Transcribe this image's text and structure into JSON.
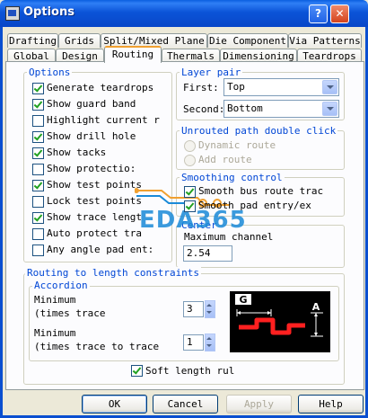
{
  "window": {
    "title": "Options",
    "help_symbol": "?",
    "close_symbol": "✕"
  },
  "tabs_row1": [
    "Drafting",
    "Grids",
    "Split/Mixed Plane",
    "Die Component",
    "Via Patterns"
  ],
  "tabs_row2": [
    "Global",
    "Design",
    "Routing",
    "Thermals",
    "Dimensioning",
    "Teardrops"
  ],
  "active_tab": "Routing",
  "options": {
    "group_label": "Options",
    "items": [
      {
        "label": "Generate teardrops",
        "checked": true
      },
      {
        "label": "Show guard band",
        "checked": true
      },
      {
        "label": "Highlight current r",
        "checked": false
      },
      {
        "label": "Show drill hole",
        "checked": true
      },
      {
        "label": "Show tacks",
        "checked": true
      },
      {
        "label": "Show protectio:",
        "checked": false
      },
      {
        "label": "Show test points",
        "checked": true
      },
      {
        "label": "Lock test points",
        "checked": false
      },
      {
        "label": "Show trace lengt",
        "checked": true
      },
      {
        "label": "Auto protect tra",
        "checked": false
      },
      {
        "label": "Any angle pad ent:",
        "checked": false
      }
    ]
  },
  "layer_pair": {
    "group_label": "Layer pair",
    "first_label": "First:",
    "first_value": "Top",
    "second_label": "Second:",
    "second_value": "Bottom"
  },
  "unrouted": {
    "group_label": "Unrouted path double click",
    "options": [
      "Dynamic route",
      "Add route"
    ]
  },
  "smoothing": {
    "group_label": "Smoothing control",
    "items": [
      {
        "label": "Smooth bus route trac",
        "checked": true
      },
      {
        "label": "Smooth pad entry/ex",
        "checked": true
      }
    ]
  },
  "center": {
    "group_label": "Center",
    "max_channel_label": "Maximum channel",
    "max_channel_value": "2.54"
  },
  "routing_to_length": {
    "group_label": "Routing to length constraints",
    "accordion_label": "Accordion",
    "minimum_label1": "Minimum",
    "minimum_label2": "(times trace",
    "minimum_value": "3",
    "minimum2_label1": "Minimum",
    "minimum2_label2": "(times trace to trace",
    "minimum2_value": "1",
    "diagram_label_g": "G",
    "diagram_label_a": "A",
    "soft_length_label": "Soft length rul",
    "soft_length_checked": true
  },
  "buttons": {
    "ok": "OK",
    "cancel": "Cancel",
    "apply": "Apply",
    "help": "Help"
  },
  "watermark": "EDA365",
  "colors": {
    "accent": "#0046d5",
    "titlebar": "#0b54d8",
    "trace": "#ff2020"
  }
}
